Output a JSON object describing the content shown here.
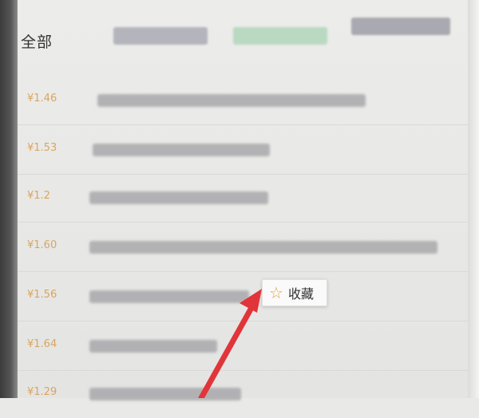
{
  "header": {
    "tab_all": "全部"
  },
  "list": {
    "prices": [
      "¥1.46",
      "¥1.53",
      "¥1.2",
      "¥1.60",
      "¥1.56",
      "¥1.64",
      "¥1.29"
    ]
  },
  "context_menu": {
    "favorite_label": "收藏",
    "favorite_icon": "star-outline-icon"
  },
  "colors": {
    "price": "#d79a4a",
    "star": "#e3a33b",
    "arrow": "#e0353a"
  }
}
